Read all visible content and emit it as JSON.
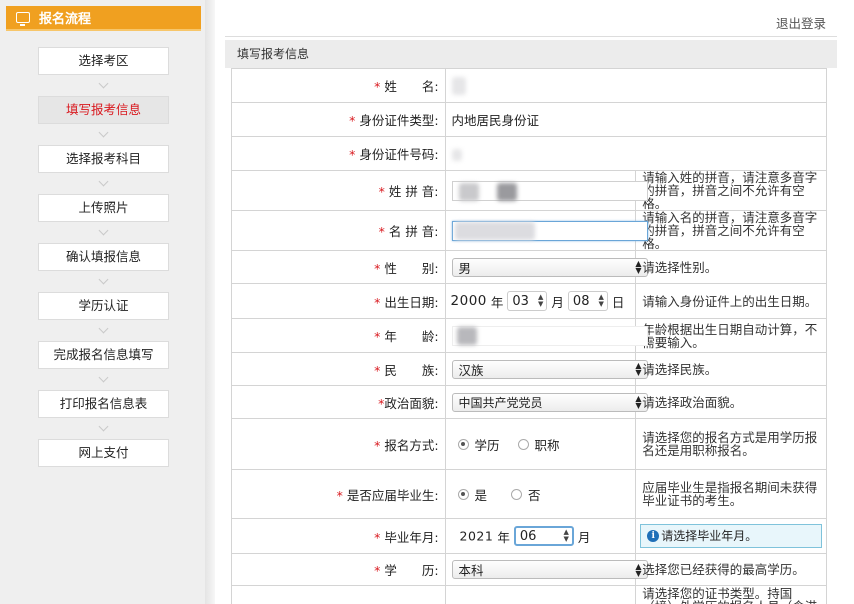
{
  "sidebar": {
    "title": "报名流程",
    "steps": [
      "选择考区",
      "填写报考信息",
      "选择报考科目",
      "上传照片",
      "确认填报信息",
      "学历认证",
      "完成报名信息填写",
      "打印报名信息表",
      "网上支付"
    ],
    "active_index": 1
  },
  "header": {
    "logout": "退出登录"
  },
  "section_title": "填写报考信息",
  "required_mark": "*",
  "form": {
    "name_label": "姓　　名:",
    "id_type_label": "身份证件类型:",
    "id_type_value": "内地居民身份证",
    "id_number_label": "身份证件号码:",
    "surname_pinyin_label": "姓 拼 音:",
    "surname_pinyin_hint": "请输入姓的拼音，请注意多音字的拼音，拼音之间不允许有空格。",
    "given_pinyin_label": "名 拼 音:",
    "given_pinyin_hint": "请输入名的拼音，请注意多音字的拼音，拼音之间不允许有空格。",
    "gender_label": "性　　别:",
    "gender_value": "男",
    "gender_hint": "请选择性别。",
    "birth_label": "出生日期:",
    "birth_year": "2000",
    "birth_month": "03",
    "birth_day": "08",
    "unit_year": "年",
    "unit_month": "月",
    "unit_day": "日",
    "birth_hint": "请输入身份证件上的出生日期。",
    "age_label": "年　　龄:",
    "age_hint": "年龄根据出生日期自动计算，不需要输入。",
    "ethnicity_label": "民　　族:",
    "ethnicity_value": "汉族",
    "ethnicity_hint": "请选择民族。",
    "political_label": "政治面貌:",
    "political_value": "中国共产党党员",
    "political_hint": "请选择政治面貌。",
    "apply_method_label": "报名方式:",
    "apply_method_options": [
      "学历",
      "职称"
    ],
    "apply_method_hint": "请选择您的报名方式是用学历报名还是用职称报名。",
    "fresh_grad_label": "是否应届毕业生:",
    "fresh_grad_options": [
      "是",
      "否"
    ],
    "fresh_grad_hint": "应届毕业生是指报名期间未获得毕业证书的考生。",
    "grad_date_label": "毕业年月:",
    "grad_year": "2021",
    "grad_month": "06",
    "grad_tip_icon": "i",
    "grad_tip": "请选择毕业年月。",
    "education_label": "学　　历:",
    "education_value": "本科",
    "education_hint": "选择您已经获得的最高学历。",
    "cert_hint": "请选择您的证书类型。持国（境）外学历的报名人员（含港澳台居民居住证持有人）请选择教留服学历认证书，填报的教留服学历书中"
  }
}
